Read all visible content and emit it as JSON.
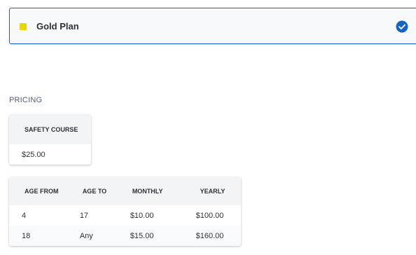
{
  "plan": {
    "name": "Gold Plan",
    "swatch_color": "#e6d700",
    "selected": true,
    "check_icon": "check-circle-icon",
    "accent_color": "#1565c0"
  },
  "pricing": {
    "section_title": "PRICING",
    "course": {
      "header": "SAFETY COURSE",
      "value": "$25.00"
    },
    "rates": {
      "headers": [
        "AGE FROM",
        "AGE TO",
        "MONTHLY",
        "YEARLY"
      ],
      "rows": [
        [
          "4",
          "17",
          "$10.00",
          "$100.00"
        ],
        [
          "18",
          "Any",
          "$15.00",
          "$160.00"
        ]
      ]
    }
  }
}
